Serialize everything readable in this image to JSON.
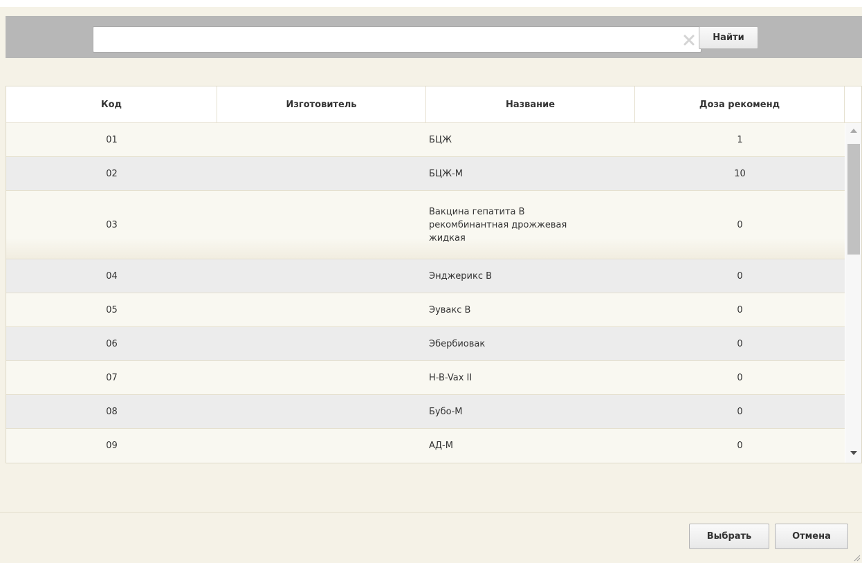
{
  "search": {
    "value": "",
    "placeholder": "",
    "find_label": "Найти"
  },
  "grid": {
    "columns": [
      "Код",
      "Изготовитель",
      "Название",
      "Доза рекоменд"
    ],
    "rows": [
      {
        "code": "01",
        "manufacturer": "",
        "name": "БЦЖ",
        "dose": "1"
      },
      {
        "code": "02",
        "manufacturer": "",
        "name": "БЦЖ-М",
        "dose": "10"
      },
      {
        "code": "03",
        "manufacturer": "",
        "name": "Вакцина гепатита В рекомбинантная дрожжевая жидкая",
        "name_lines": [
          "Вакцина гепатита В",
          "рекомбинантная дрожжевая",
          "жидкая"
        ],
        "dose": "0"
      },
      {
        "code": "04",
        "manufacturer": "",
        "name": "Энджерикс В",
        "dose": "0"
      },
      {
        "code": "05",
        "manufacturer": "",
        "name": "Эувакс В",
        "dose": "0"
      },
      {
        "code": "06",
        "manufacturer": "",
        "name": "Эбербиовак",
        "dose": "0"
      },
      {
        "code": "07",
        "manufacturer": "",
        "name": "H-B-Vax II",
        "dose": "0"
      },
      {
        "code": "08",
        "manufacturer": "",
        "name": "Бубо-М",
        "dose": "0"
      },
      {
        "code": "09",
        "manufacturer": "",
        "name": "АД-М",
        "dose": "0"
      }
    ]
  },
  "footer": {
    "select_label": "Выбрать",
    "cancel_label": "Отмена"
  },
  "icons": {
    "clear": "clear-x-icon",
    "scroll_up": "scroll-up-arrow-icon",
    "scroll_down": "scroll-down-arrow-icon",
    "resize": "resize-grip-icon"
  },
  "colors": {
    "dialog_bg": "#f5f2e7",
    "search_bar_bg": "#b7b7b7",
    "row_odd": "#f9f8f1",
    "row_even": "#ececec"
  }
}
